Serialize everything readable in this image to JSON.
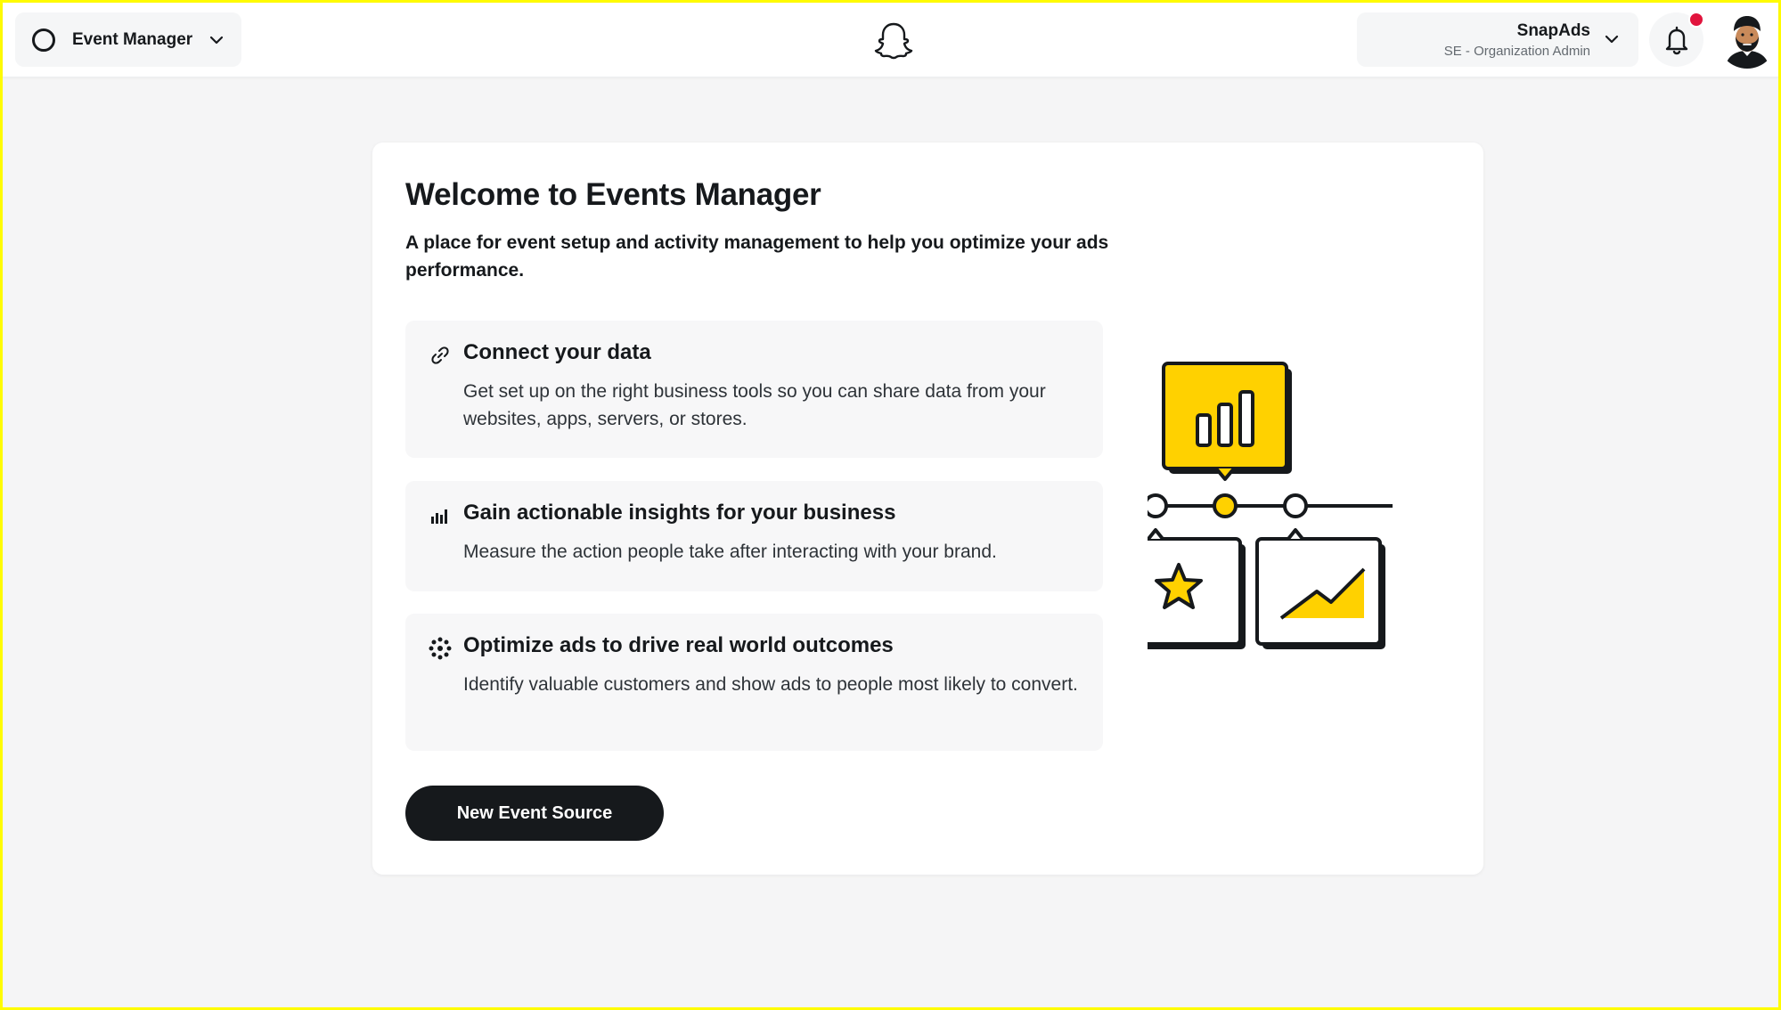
{
  "header": {
    "app_switcher_label": "Event Manager",
    "account_name": "SnapAds",
    "account_role": "SE - Organization Admin",
    "notification_dot": true
  },
  "card": {
    "title": "Welcome to Events Manager",
    "subtitle": "A place for event setup and activity management to help you optimize your ads performance.",
    "features": [
      {
        "icon": "link-icon",
        "title": "Connect your data",
        "description": "Get set up on the right business tools so you can share data from your websites, apps, servers, or stores."
      },
      {
        "icon": "bar-chart-icon",
        "title": "Gain actionable insights for your business",
        "description": "Measure the action people take after interacting with your brand."
      },
      {
        "icon": "target-dots-icon",
        "title": "Optimize ads to drive real world outcomes",
        "description": "Identify valuable customers and show ads to people most likely to convert."
      }
    ],
    "primary_button_label": "New Event Source"
  },
  "colors": {
    "brand_yellow": "#fffc00",
    "illustration_yellow": "#ffd100",
    "dark": "#16191c",
    "notification_red": "#e1143d"
  }
}
